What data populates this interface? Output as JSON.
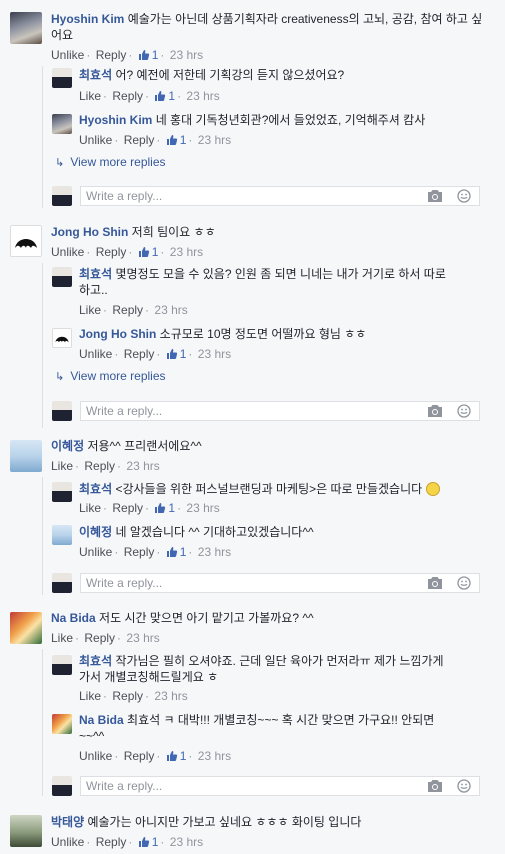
{
  "labels": {
    "like": "Like",
    "unlike": "Unlike",
    "reply": "Reply",
    "separator": "·",
    "view_more": "View more replies",
    "reply_placeholder": "Write a reply..."
  },
  "threads": [
    {
      "author": "Hyoshin Kim",
      "text_line1": "예술가는 아닌데 상품기획자라 creativeness의 고뇌, 공감, 참여 하고 싶어요",
      "text_line2": "고 싶어요",
      "action": "Unlike",
      "likes": "1",
      "time": "23 hrs",
      "replies": [
        {
          "author": "최효석",
          "text": "어? 예전에 저한테 기획강의 듣지 않으셨어요?",
          "action": "Like",
          "likes": "1",
          "time": "23 hrs"
        },
        {
          "author": "Hyoshin Kim",
          "text": "네 홍대 기독청년회관?에서 들었었죠, 기억해주셔 캄사",
          "action": "Unlike",
          "likes": "1",
          "time": "23 hrs"
        }
      ]
    },
    {
      "author": "Jong Ho Shin",
      "text": "저희 팀이요 ㅎㅎ",
      "action": "Unlike",
      "likes": "1",
      "time": "23 hrs",
      "replies": [
        {
          "author": "최효석",
          "text": "몇명정도 모을 수 있음? 인원 좀 되면 니네는 내가 거기로 하서 따로",
          "text2": "하고..",
          "action": "Like",
          "likes": "",
          "time": "23 hrs"
        },
        {
          "author": "Jong Ho Shin",
          "text": "소규모로 10명 정도면 어떨까요 형님 ㅎㅎ",
          "action": "Unlike",
          "likes": "1",
          "time": "23 hrs"
        }
      ]
    },
    {
      "author": "이혜정",
      "text": "저용^^ 프리랜서에요^^",
      "action": "Like",
      "likes": "",
      "time": "23 hrs",
      "replies": [
        {
          "author": "최효석",
          "text": "<강사들을 위한 퍼스널브랜딩과 마케팅>은 따로 만들겠습니다",
          "action": "Like",
          "likes": "1",
          "time": "23 hrs"
        },
        {
          "author": "이혜정",
          "text": "네 알겠습니다 ^^ 기대하고있겠습니다^^",
          "action": "Unlike",
          "likes": "1",
          "time": "23 hrs"
        }
      ]
    },
    {
      "author": "Na Bida",
      "text": "저도 시간 맞으면 아기 맡기고 가볼까요? ^^",
      "action": "Like",
      "likes": "",
      "time": "23 hrs",
      "replies": [
        {
          "author": "최효석",
          "text": "작가님은 필히 오셔야죠. 근데 일단 육아가 먼저라ㅠ 제가 느낌가게",
          "text2": "가서 개별코칭해드릴게요 ㅎ",
          "action": "Like",
          "likes": "",
          "time": "23 hrs"
        },
        {
          "author": "Na Bida",
          "text": "최효석 ㅋ 대박!!! 개별코칭~~~ 혹 시간 맞으면 가구요!! 안되면",
          "text2": "~~^^",
          "action": "Unlike",
          "likes": "1",
          "time": "23 hrs"
        }
      ]
    },
    {
      "author": "박태양",
      "text": "예술가는 아니지만 가보고 싶네요 ㅎㅎㅎ 화이팅 입니다",
      "action": "Unlike",
      "likes": "1",
      "time": "23 hrs"
    }
  ],
  "colors": {
    "name": "#365899",
    "meta": "#90949c",
    "like_blue": "#4267b2",
    "background": "#f6f7f9"
  }
}
